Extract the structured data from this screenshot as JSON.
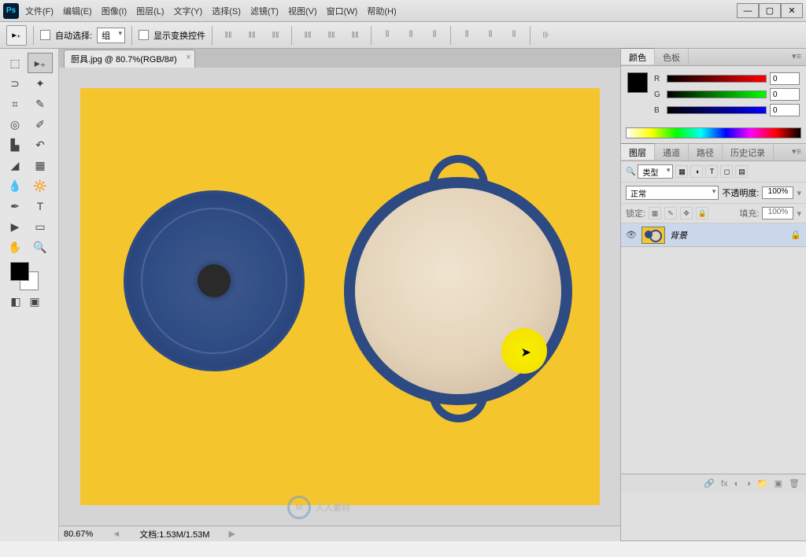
{
  "app": {
    "logo": "Ps"
  },
  "menu": [
    {
      "label": "文件(F)"
    },
    {
      "label": "编辑(E)"
    },
    {
      "label": "图像(I)"
    },
    {
      "label": "图层(L)"
    },
    {
      "label": "文字(Y)"
    },
    {
      "label": "选择(S)"
    },
    {
      "label": "滤镜(T)"
    },
    {
      "label": "视图(V)"
    },
    {
      "label": "窗口(W)"
    },
    {
      "label": "帮助(H)"
    }
  ],
  "window_controls": {
    "min": "—",
    "max": "▢",
    "close": "✕"
  },
  "options": {
    "auto_select": "自动选择:",
    "group": "组",
    "show_transform": "显示变换控件"
  },
  "document": {
    "tab_label": "厨具.jpg @ 80.7%(RGB/8#)",
    "zoom": "80.67%",
    "status": "文档:1.53M/1.53M",
    "watermark": "人人素材"
  },
  "panels": {
    "color": {
      "tab_color": "颜色",
      "tab_swatches": "色板",
      "r_label": "R",
      "r_val": "0",
      "g_label": "G",
      "g_val": "0",
      "b_label": "B",
      "b_val": "0"
    },
    "layers": {
      "tab_layers": "图层",
      "tab_channels": "通道",
      "tab_paths": "路径",
      "tab_history": "历史记录",
      "filter_type": "类型",
      "blend_mode": "正常",
      "opacity_label": "不透明度:",
      "opacity_val": "100%",
      "lock_label": "锁定:",
      "fill_label": "填充:",
      "fill_val": "100%",
      "layer_bg_name": "背景"
    }
  },
  "icons": {
    "search": "🔍",
    "eye": "👁",
    "lock": "🔒",
    "trash": "🗑",
    "folder": "📁",
    "fx": "fx",
    "link": "🔗",
    "mask": "◐",
    "new": "▣",
    "adjust": "◑"
  }
}
